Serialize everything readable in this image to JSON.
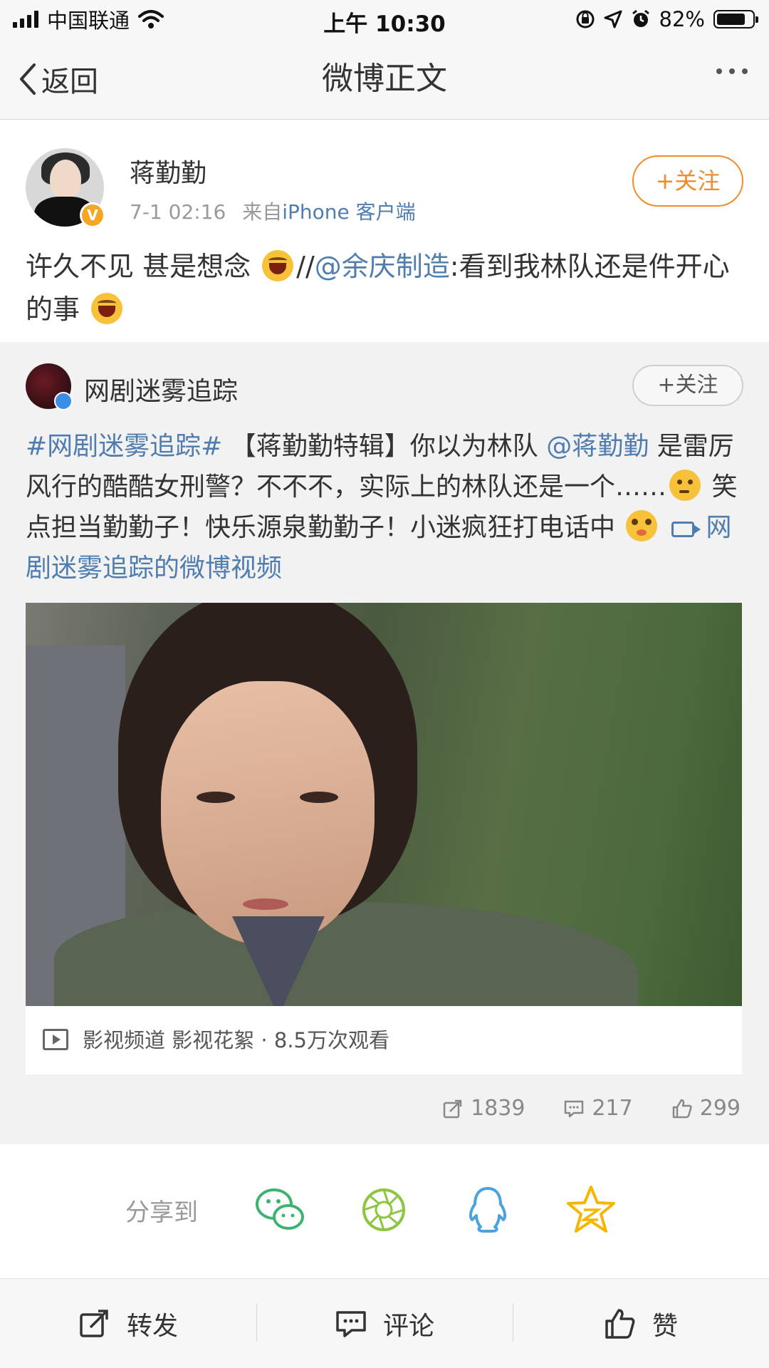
{
  "status_bar": {
    "carrier": "中国联通",
    "time": "上午 10:30",
    "battery": "82%",
    "battery_level": 0.82
  },
  "nav": {
    "back_label": "返回",
    "title": "微博正文"
  },
  "post": {
    "author": "蒋勤勤",
    "time": "7-1 02:16",
    "source_prefix": "来自",
    "source": "iPhone 客户端",
    "follow_label": "+关注",
    "text_part1": "许久不见 甚是想念 ",
    "text_sep": "//",
    "mention": "@余庆制造",
    "text_part2": ":看到我林队还是件开心的事 "
  },
  "repost": {
    "author": "网剧迷雾追踪",
    "follow_label": "+关注",
    "hashtag": "#网剧迷雾追踪#",
    "text_part1": " 【蒋勤勤特辑】你以为林队 ",
    "mention": "@蒋勤勤",
    "text_part2": " 是雷厉风行的酷酷女刑警？不不不，实际上的林队还是一个……",
    "text_part3": " 笑点担当勤勤子！快乐源泉勤勤子！小迷疯狂打电话中 ",
    "video_link": "网剧迷雾追踪的微博视频",
    "video_meta": "影视频道 影视花絮 · 8.5万次观看",
    "stats": {
      "reposts": "1839",
      "comments": "217",
      "likes": "299"
    }
  },
  "share": {
    "label": "分享到",
    "targets": [
      "wechat-icon",
      "moments-icon",
      "qq-icon",
      "qzone-icon"
    ],
    "colors": {
      "wechat": "#3cb371",
      "moments": "#8cc63f",
      "qq": "#4aa3df",
      "qzone": "#f7b500"
    }
  },
  "bottom_bar": {
    "repost": "转发",
    "comment": "评论",
    "like": "赞"
  },
  "colors": {
    "link": "#507daf",
    "follow_accent": "#f08c2a",
    "verified": "#f5a623"
  }
}
